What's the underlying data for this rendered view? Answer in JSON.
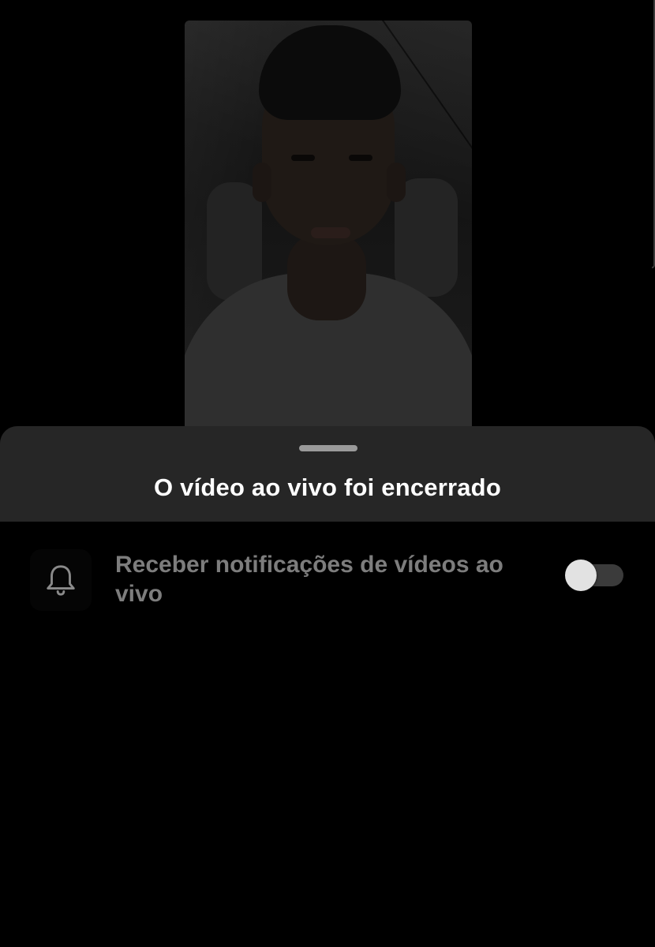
{
  "sheet": {
    "title": "O vídeo ao vivo foi encerrado"
  },
  "notification_setting": {
    "icon": "bell-icon",
    "label": "Receber notificações de vídeos ao vivo",
    "enabled": false
  },
  "colors": {
    "background": "#000000",
    "sheet_header": "#262626",
    "title_text": "#ffffff",
    "label_text": "#7d7d7d",
    "toggle_track_off": "#3b3b3b",
    "toggle_knob": "#e2e2e2"
  }
}
